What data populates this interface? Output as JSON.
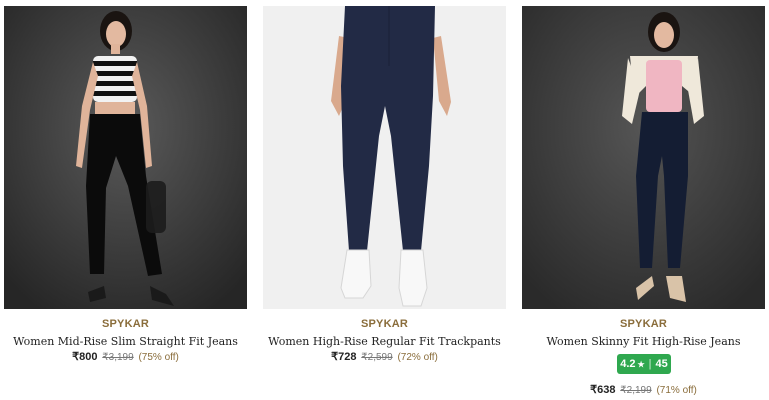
{
  "products": [
    {
      "brand": "SPYKAR",
      "title": "Women Mid-Rise Slim Straight Fit Jeans",
      "price": "₹800",
      "mrp": "₹3,199",
      "discount": "(75% off)",
      "image_icon": "model-black-jeans-image"
    },
    {
      "brand": "SPYKAR",
      "title": "Women High-Rise Regular Fit Trackpants",
      "price": "₹728",
      "mrp": "₹2,599",
      "discount": "(72% off)",
      "image_icon": "model-navy-trackpants-image"
    },
    {
      "brand": "SPYKAR",
      "title": "Women Skinny Fit High-Rise Jeans",
      "rating": "4.2",
      "rating_star": "★",
      "rating_sep": "|",
      "rating_count": "45",
      "price": "₹638",
      "mrp": "₹2,199",
      "discount": "(71% off)",
      "image_icon": "model-dark-blue-jeans-image"
    }
  ],
  "colors": {
    "brand": "#8a6d3b",
    "rating_badge": "#2fa84f",
    "dark_bg": "#3a3a3a",
    "light_bg": "#f0f0f0"
  }
}
